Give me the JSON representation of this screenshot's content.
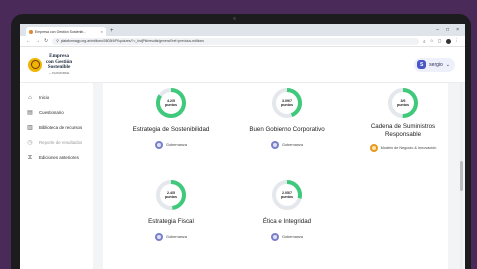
{
  "browser": {
    "tab_title": "Empresa con Gestión Sostenib...",
    "tab_close": "×",
    "new_tab": "+",
    "url": "plataformagp.org.ar/editions/0803f4/Pl/quizzes/?=_hstjPik/results/general?ref=previous-editions",
    "window_controls": [
      "–",
      "□",
      "×"
    ]
  },
  "header": {
    "brand_name_line1": "Empresa",
    "brand_name_line2": "con Gestión",
    "brand_name_line3": "Sostenible",
    "brand_sub": "— PLATAFORMA",
    "user_initial": "S",
    "user_name": "sergio",
    "user_chevron": "⌄"
  },
  "sidebar": {
    "items": [
      {
        "label": "Inicio",
        "icon": "home-icon",
        "glyph": "⌂",
        "muted": false
      },
      {
        "label": "Cuestionario",
        "icon": "clipboard-icon",
        "glyph": "▤",
        "muted": false
      },
      {
        "label": "Biblioteca de recursos",
        "icon": "library-icon",
        "glyph": "▥",
        "muted": false
      },
      {
        "label": "Reporte de resultados",
        "icon": "report-icon",
        "glyph": "◷",
        "muted": true
      },
      {
        "label": "Ediciones anteriores",
        "icon": "history-icon",
        "glyph": "⧖",
        "muted": false
      }
    ]
  },
  "categories": [
    {
      "name": "Estrategia de Sostenibilidad",
      "score_text": "4.2/5",
      "unit": "puntos",
      "fraction": 0.84,
      "tag": "Gobernanza",
      "tag_color": "#7a7fc9"
    },
    {
      "name": "Buen Gobierno Corporativo",
      "score_text": "3.09/7",
      "unit": "puntos",
      "fraction": 0.44,
      "tag": "Gobernanza",
      "tag_color": "#7a7fc9"
    },
    {
      "name": "Cadena de Suministros Responsable",
      "score_text": "3/6",
      "unit": "puntos",
      "fraction": 0.5,
      "tag": "Modelo de Negocio & Innovación",
      "tag_color": "#e89a1c"
    },
    {
      "name": "Estrategia Fiscal",
      "score_text": "2.4/5",
      "unit": "puntos",
      "fraction": 0.48,
      "tag": "Gobernanza",
      "tag_color": "#7a7fc9"
    },
    {
      "name": "Ética e Integridad",
      "score_text": "2.05/7",
      "unit": "puntos",
      "fraction": 0.29,
      "tag": "Gobernanza",
      "tag_color": "#7a7fc9"
    }
  ],
  "colors": {
    "gauge_fill": "#3fc97a",
    "gauge_track": "#e4e7ec",
    "accent": "#4a56c8"
  }
}
